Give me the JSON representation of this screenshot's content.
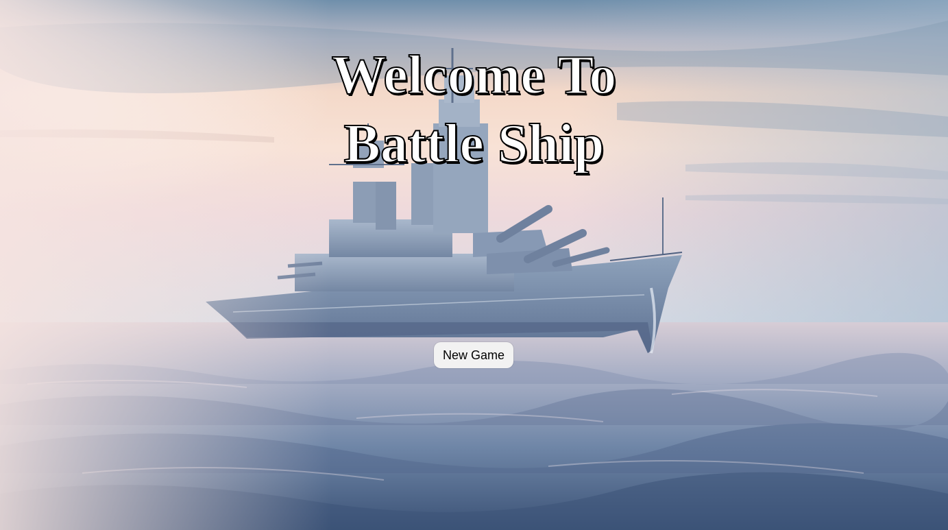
{
  "title": {
    "line1": "Welcome To",
    "line2": "Battle Ship"
  },
  "menu": {
    "new_game_label": "New Game"
  },
  "background": {
    "subject": "battleship-at-sea",
    "sky_colors": [
      "#7d9db8",
      "#f6dccb",
      "#f2d8d6",
      "#c9d6e3"
    ],
    "sea_colors": [
      "#c8b8c6",
      "#7f94b2",
      "#3e5577"
    ],
    "ship_color": "#7f93ad"
  }
}
